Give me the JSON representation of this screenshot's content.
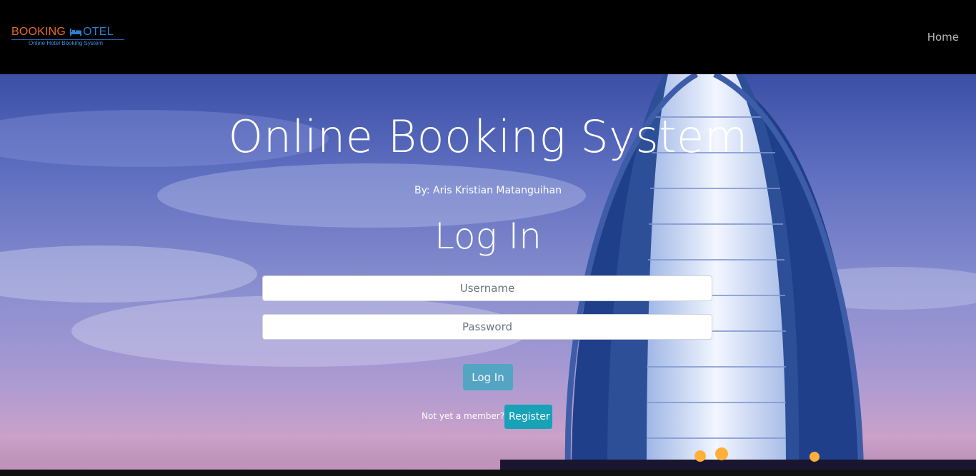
{
  "navbar": {
    "logo": {
      "booking_text": "BOOKING",
      "hotel_text": "OTEL",
      "tagline": "Online Hotel Booking System",
      "colors": {
        "booking": "#e86a2a",
        "hotel": "#2a7fd0"
      }
    },
    "home_link": "Home"
  },
  "hero": {
    "title": "Online Booking System",
    "byline": "By: Aris Kristian Matanguihan",
    "background_image": "hotel-tower-sky-photo"
  },
  "login_form": {
    "heading": "Log In",
    "username_placeholder": "Username",
    "password_placeholder": "Password",
    "submit_label": "Log In",
    "member_prompt": "Not yet a member?",
    "register_label": "Register",
    "colors": {
      "login_button": "#4aa7c2",
      "register_button": "#17a2b8"
    }
  }
}
